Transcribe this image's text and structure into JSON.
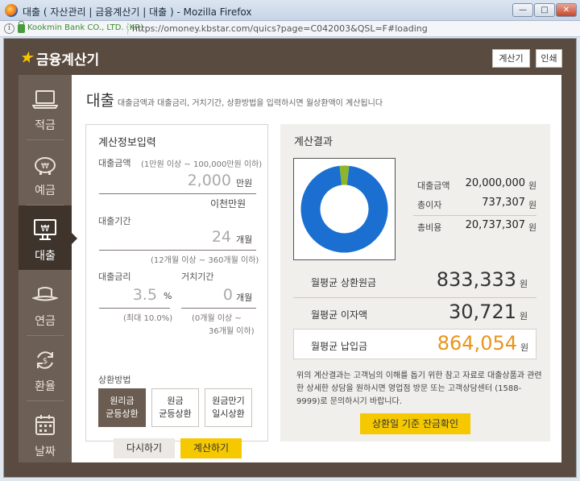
{
  "window": {
    "title": "대출 ( 자산관리 | 금융계산기 | 대출 ) - Mozilla Firefox",
    "site_identity": "Kookmin Bank CO., LTD. (KR)",
    "url": "https://omoney.kbstar.com/quics?page=C042003&QSL=F#loading",
    "controls": {
      "minimize": "—",
      "maximize": "□",
      "close": "✕"
    }
  },
  "header": {
    "logo": "★",
    "title": "금융계산기",
    "calculator_btn": "계산기",
    "print_btn": "인쇄"
  },
  "sidebar": {
    "items": [
      {
        "label": "적금",
        "icon": "laptop-icon"
      },
      {
        "label": "예금",
        "icon": "piggy-bank-icon"
      },
      {
        "label": "대출",
        "icon": "monitor-won-icon",
        "active": true
      },
      {
        "label": "연금",
        "icon": "hat-icon"
      },
      {
        "label": "환율",
        "icon": "exchange-icon"
      },
      {
        "label": "날짜",
        "icon": "calendar-icon"
      }
    ]
  },
  "page": {
    "title": "대출",
    "desc": "대출금액과 대출금리, 거치기간, 상환방법을 입력하시면 월상환액이 계산됩니다"
  },
  "input": {
    "title": "계산정보입력",
    "amount_label": "대출금액",
    "amount_hint": "(1만원 이상 ~ 100,000만원 이하)",
    "amount_value": "2,000",
    "amount_unit": "만원",
    "amount_korean": "이천만원",
    "period_label": "대출기간",
    "period_value": "24",
    "period_unit": "개월",
    "period_hint": "(12개월 이상 ~ 360개월 이하)",
    "rate_label": "대출금리",
    "rate_value": "3.5",
    "rate_unit": "%",
    "rate_hint": "(최대 10.0%)",
    "grace_label": "거치기간",
    "grace_value": "0",
    "grace_unit": "개월",
    "grace_hint_1": "(0개월 이상 ~",
    "grace_hint_2": "36개월 이하)",
    "method_label": "상환방법",
    "methods": [
      {
        "line1": "원리금",
        "line2": "균등상환",
        "selected": true
      },
      {
        "line1": "원금",
        "line2": "균등상환",
        "selected": false
      },
      {
        "line1": "원금만기",
        "line2": "일시상환",
        "selected": false
      }
    ],
    "reset_btn": "다시하기",
    "calc_btn": "계산하기"
  },
  "result": {
    "title": "계산결과",
    "principal_label": "대출금액",
    "principal_value": "20,000,000",
    "won": "원",
    "interest_label": "총이자",
    "interest_value": "737,307",
    "total_label": "총비용",
    "total_value": "20,737,307",
    "monthly_principal_label": "월평균 상환원금",
    "monthly_principal_value": "833,333",
    "monthly_interest_label": "월평균 이자액",
    "monthly_interest_value": "30,721",
    "monthly_payment_label": "월평균 납입금",
    "monthly_payment_value": "864,054",
    "notice": "위의 계산결과는 고객님의 이해를 돕기 위한 참고 자료로 대출상품과 관련한 상세한 상담을 원하시면 영업점 방문 또는 고객상담센터 (1588-9999)로 문의하시기 바랍니다.",
    "confirm_btn": "상환일 기준 잔금확인"
  },
  "colors": {
    "accent": "#f5c800",
    "brand_brown": "#5a4b40",
    "donut_principal": "#1b6fd1",
    "donut_interest": "#8fb52a",
    "highlight_text": "#e8951a"
  },
  "chart_data": {
    "type": "pie",
    "categories": [
      "대출금액",
      "총이자"
    ],
    "values": [
      20000000,
      737307
    ],
    "title": "",
    "donut": true
  }
}
